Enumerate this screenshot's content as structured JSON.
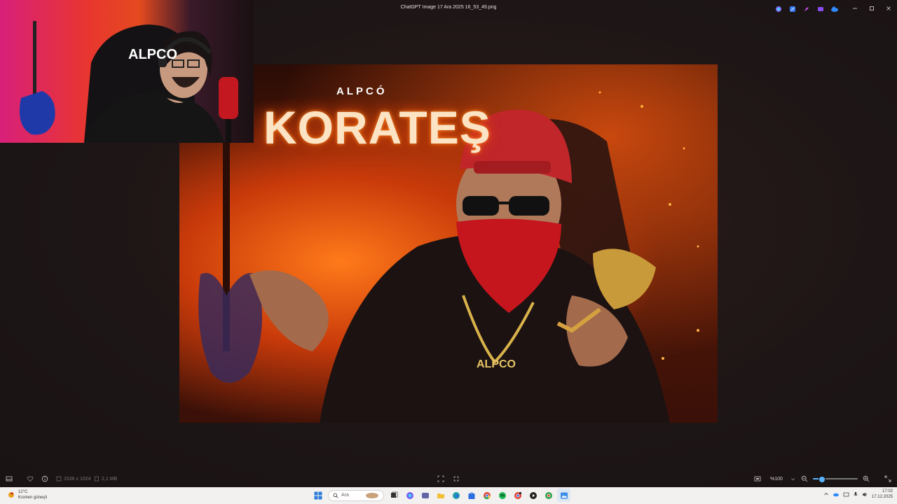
{
  "window": {
    "title": "ChatGPT Image 17 Ara 2025 16_53_49.png",
    "controls": [
      "minimize",
      "maximize",
      "close"
    ]
  },
  "title_icons": [
    "copilot-icon",
    "edit-icon",
    "paint-icon",
    "clipchamp-icon",
    "onedrive-icon"
  ],
  "webcam": {
    "chair_text": "ALPCO"
  },
  "image": {
    "brand": "ALPCÓ",
    "headline": "KORATEŞ",
    "chain_text": "ALPCO"
  },
  "toolbar": {
    "dimensions": "1536 x 1024",
    "size": "2,1 MB",
    "zoom": "%100",
    "zoom_level": 0.18
  },
  "taskbar": {
    "weather_temp": "12°C",
    "weather_desc": "Kısmen güneşli",
    "search_placeholder": "Ara",
    "time": "17:02",
    "date": "17.12.2025"
  },
  "colors": {
    "accent": "#5ab3ff",
    "background": "#1b1414",
    "taskbar": "#f3f0f0"
  }
}
